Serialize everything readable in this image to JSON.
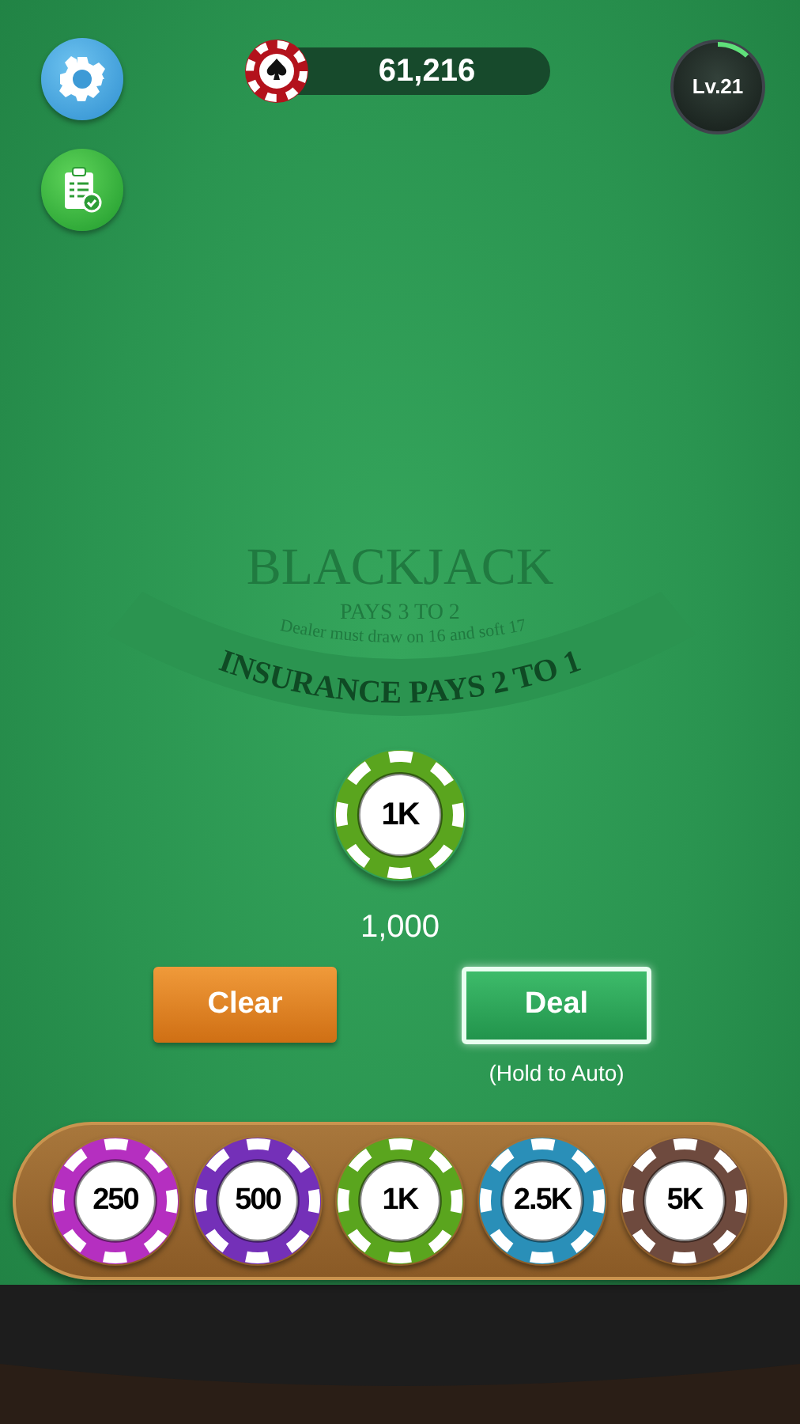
{
  "balance": {
    "amount": "61,216"
  },
  "level_badge": {
    "label": "Lv.21",
    "level": 0.12
  },
  "table": {
    "title": "BLACKJACK",
    "payout": "PAYS 3 TO 2",
    "dealer_rule": "Dealer must draw on 16 and soft 17",
    "insurance": "INSURANCE PAYS 2 TO 1"
  },
  "bet": {
    "chip_label": "1K",
    "color": "#5aa51e",
    "amount": "1,000"
  },
  "buttons": [
    {
      "kind": "clear",
      "label": "Clear"
    },
    {
      "kind": "deal",
      "label": "Deal",
      "hint": "(Hold to Auto)"
    }
  ],
  "chips": [
    {
      "label": "250",
      "color": "#b52fc0"
    },
    {
      "label": "500",
      "color": "#7430b8"
    },
    {
      "label": "1K",
      "color": "#5aa51e"
    },
    {
      "label": "2.5K",
      "color": "#2a8fb8"
    },
    {
      "label": "5K",
      "color": "#6e4a3e"
    }
  ]
}
